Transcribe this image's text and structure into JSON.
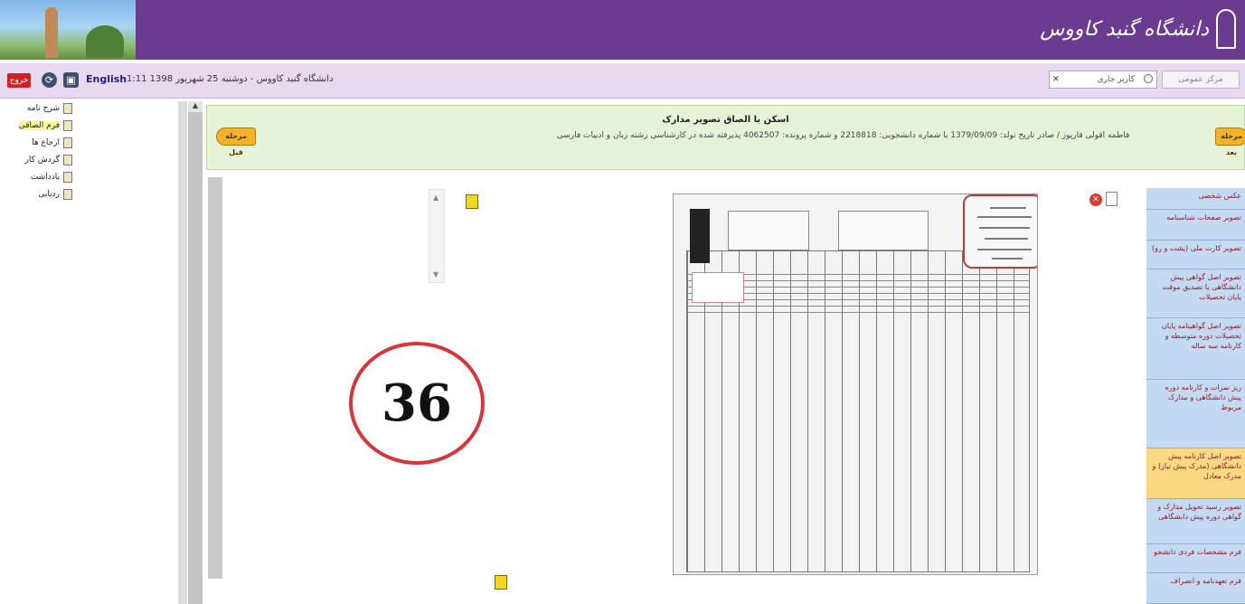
{
  "header": {
    "university_name": "دانشگاه گنبد کاووس"
  },
  "toolbar": {
    "logout_label": "خروج",
    "language_label": "English",
    "info_text": "دانشگاه گنبد کاووس - دوشنبه 25 شهریور 1398 1:11",
    "search_value": "کاربر جاری",
    "search_button_label": "مرکز عمومی"
  },
  "sidebar": {
    "items": [
      {
        "label": "شرح نامه",
        "active": false
      },
      {
        "label": "فرم الصاقی",
        "active": true
      },
      {
        "label": "ارجاع ها",
        "active": false
      },
      {
        "label": "گردش کار",
        "active": false
      },
      {
        "label": "یادداشت",
        "active": false
      },
      {
        "label": "ردیابی",
        "active": false
      }
    ]
  },
  "info_bar": {
    "title": "اسکن یا الصاق تصویر مدارک",
    "description": "فاطمه آقولی قارپوز / صادر تاریخ تولد: 1379/09/09 با شماره دانشجویی: 2218818 و شماره پرونده: 4062507 پذیرفته شده در کارشناسی رشته زبان و ادبیات فارسی",
    "prev_label": "مرحله قبل",
    "next_label": "مرحله بعد"
  },
  "page_number": "36",
  "right_panel": {
    "items": [
      {
        "label": "عکس شخصی",
        "active": false
      },
      {
        "label": "تصویر صفحات شناسنامه",
        "active": false
      },
      {
        "label": "تصویر کارت ملی (پشت و رو)",
        "active": false
      },
      {
        "label": "تصویر اصل گواهی پیش دانشگاهی یا تصدیق موقت پایان تحصیلات",
        "active": false
      },
      {
        "label": "تصویر اصل گواهینامه پایان تحصیلات دوره متوسطه و کارنامه سه ساله",
        "active": false
      },
      {
        "label": "ریز نمرات و کارنامه دوره پیش دانشگاهی و مدارک مربوط",
        "active": false
      },
      {
        "label": "تصویر اصل کارنامه پیش دانشگاهی (مدرک پیش نیاز) و مدرک معادل",
        "active": true
      },
      {
        "label": "تصویر رسید تحویل مدارک و گواهی دوره پیش دانشگاهی",
        "active": false
      },
      {
        "label": "فرم مشخصات فردی دانشجو",
        "active": false
      },
      {
        "label": "فرم تعهدنامه و انصراف",
        "active": false
      }
    ]
  }
}
